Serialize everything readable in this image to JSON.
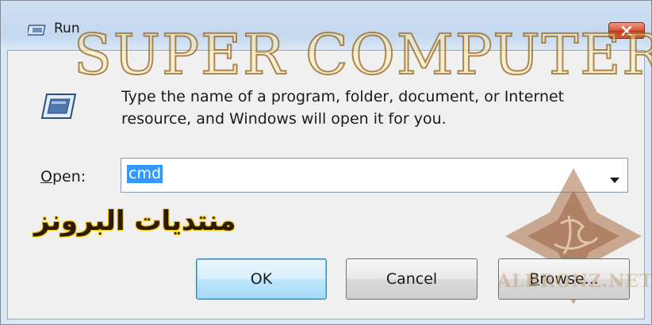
{
  "window": {
    "title": "Run",
    "icon": "run-icon",
    "close_icon": "close-icon"
  },
  "content": {
    "icon": "run-program-icon",
    "description": "Type the name of a program, folder, document, or Internet resource, and Windows will open it for you."
  },
  "open_field": {
    "label_accel": "O",
    "label_rest": "pen:",
    "value": "cmd",
    "dropdown_icon": "chevron-down-icon"
  },
  "buttons": {
    "ok": "OK",
    "cancel": "Cancel",
    "browse_accel": "B",
    "browse_rest": "rowse..."
  },
  "overlays": {
    "watermark": "SUPER COMPUTER",
    "forum_name": "منتديات البرونز",
    "site_mark": "ALBRONZ.NET",
    "emblem": "arabic-calligraphy-emblem"
  },
  "colors": {
    "selection": "#3399ff",
    "title_bar": "#c4d8ef",
    "close_button": "#d85b40"
  }
}
